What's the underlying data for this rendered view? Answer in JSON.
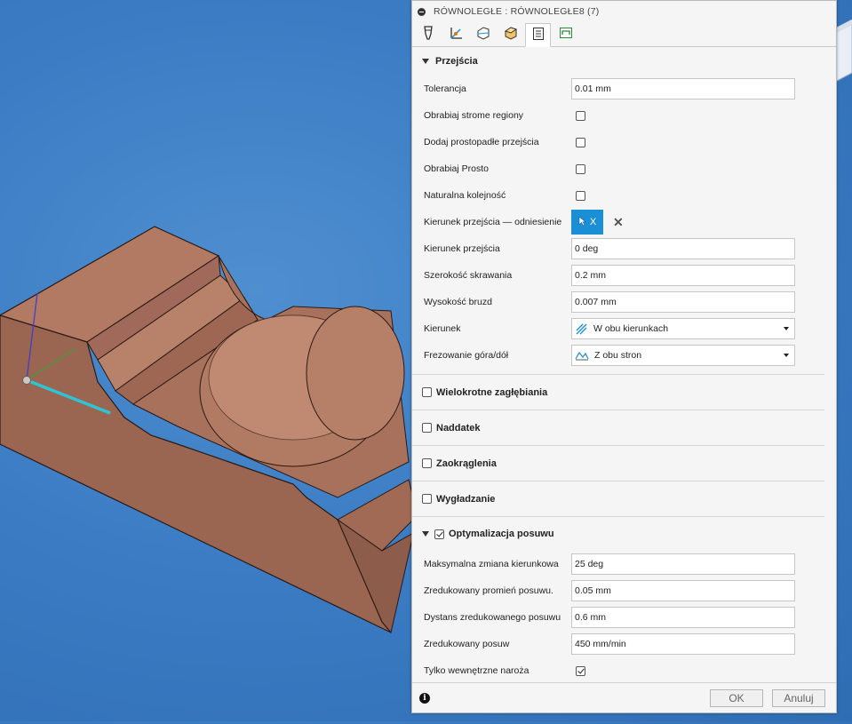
{
  "dialog": {
    "title": "RÓWNOLEGŁE : RÓWNOLEGŁE8 (7)",
    "tabs": [
      {
        "icon": "tool-icon"
      },
      {
        "icon": "geometry-icon"
      },
      {
        "icon": "heights-icon"
      },
      {
        "icon": "stock-icon"
      },
      {
        "icon": "passes-icon",
        "active": true
      },
      {
        "icon": "linking-icon"
      }
    ]
  },
  "passes": {
    "header": "Przejścia",
    "tolerance_label": "Tolerancja",
    "tolerance_value": "0.01 mm",
    "steep_label": "Obrabiaj strome regiony",
    "perpendicular_label": "Dodaj prostopadłe przejścia",
    "straight_label": "Obrabiaj Prosto",
    "natural_order_label": "Naturalna kolejność",
    "direction_ref_label": "Kierunek przejścia — odniesienie",
    "direction_ref_button": "X",
    "direction_label": "Kierunek przejścia",
    "direction_value": "0 deg",
    "stepover_label": "Szerokość skrawania",
    "stepover_value": "0.2 mm",
    "scallop_label": "Wysokość bruzd",
    "scallop_value": "0.007 mm",
    "dir_mode_label": "Kierunek",
    "dir_mode_value": "W obu kierunkach",
    "updown_label": "Frezowanie góra/dół",
    "updown_value": "Z obu stron"
  },
  "groups": {
    "multiple_depths": "Wielokrotne zagłębiania",
    "stock_to_leave": "Naddatek",
    "fillets": "Zaokrąglenia",
    "smoothing": "Wygładzanie",
    "feed_optimization": "Optymalizacja posuwu"
  },
  "feed": {
    "max_dir_change_label": "Maksymalna zmiana kierunkowa",
    "max_dir_change_value": "25 deg",
    "reduced_radius_label": "Zredukowany promień posuwu.",
    "reduced_radius_value": "0.05 mm",
    "reduced_distance_label": "Dystans zredukowanego posuwu",
    "reduced_distance_value": "0.6 mm",
    "reduced_feed_label": "Zredukowany posuw",
    "reduced_feed_value": "450 mm/min",
    "inner_corners_label": "Tylko wewnętrzne naroża"
  },
  "footer": {
    "ok": "OK",
    "cancel": "Anuluj"
  },
  "colors": {
    "accent": "#1a8fd6",
    "background_blue": "#3b7cc4",
    "model": "#a9705a"
  }
}
